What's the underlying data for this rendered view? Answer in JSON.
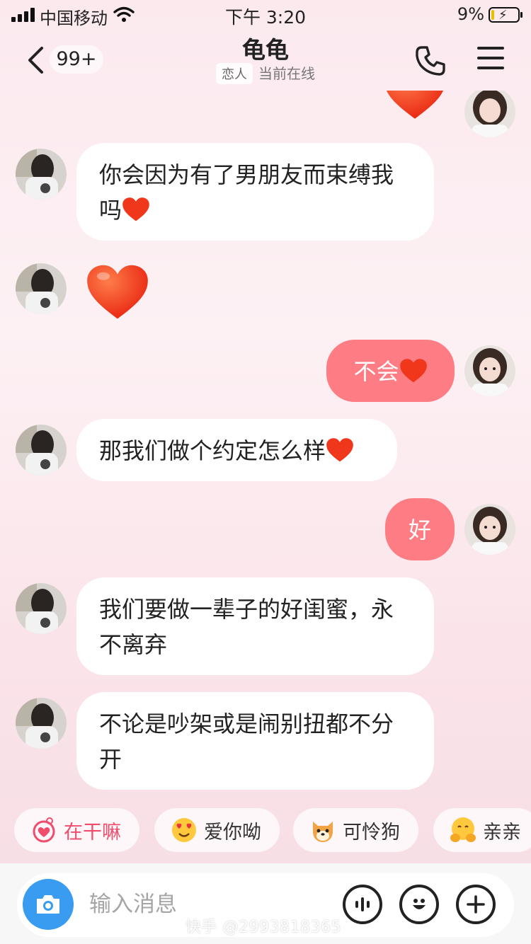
{
  "status_bar": {
    "carrier": "中国移动",
    "time": "下午 3:20",
    "battery": "9%"
  },
  "header": {
    "back_badge": "99+",
    "title": "龟龟",
    "relation_tag": "恋人",
    "status": "当前在线"
  },
  "messages": [
    {
      "from": "other",
      "text": "你会因为有了男朋友而束缚我",
      "text2": "吗",
      "emoji": "red-heart"
    },
    {
      "from": "other",
      "type": "big-heart"
    },
    {
      "from": "me",
      "text": "不会",
      "emoji": "red-heart"
    },
    {
      "from": "other",
      "text": "那我们做个约定怎么样",
      "emoji": "red-heart"
    },
    {
      "from": "me",
      "text": "好"
    },
    {
      "from": "other",
      "text": "我们要做一辈子的好闺蜜，永",
      "text2": "不离弃"
    },
    {
      "from": "other",
      "text": "不论是吵架或是闹别扭都不分",
      "text2": "开"
    }
  ],
  "quick_replies": [
    {
      "label": "在干嘛",
      "icon": "heart-hand-icon"
    },
    {
      "label": "爱你呦",
      "icon": "heart-eyes-icon"
    },
    {
      "label": "可怜狗",
      "icon": "puppy-icon"
    },
    {
      "label": "亲亲",
      "icon": "hug-icon"
    }
  ],
  "input": {
    "placeholder": "输入消息"
  },
  "watermark": "快手 @2993818365",
  "colors": {
    "outgoing_bubble": "#fe7d84",
    "camera_button": "#3a9cf0",
    "heart": "#f03a1c"
  }
}
